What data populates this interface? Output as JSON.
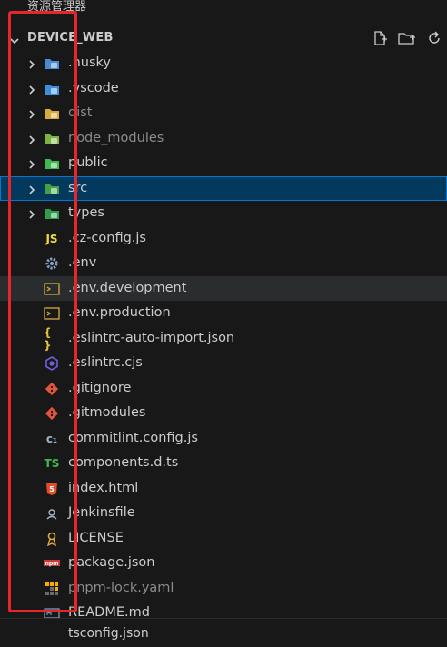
{
  "panel": {
    "title": "资源管理器"
  },
  "section": {
    "title": "DEVICE_WEB",
    "actions": [
      {
        "name": "new-file-icon"
      },
      {
        "name": "new-folder-icon"
      },
      {
        "name": "refresh-icon"
      }
    ]
  },
  "tree": [
    {
      "label": ".husky",
      "kind": "folder",
      "icon": "husky-folder-icon",
      "color": "#4a8bd1",
      "dim": false
    },
    {
      "label": ".vscode",
      "kind": "folder",
      "icon": "vscode-folder-icon",
      "color": "#3c8fd9",
      "dim": false
    },
    {
      "label": "dist",
      "kind": "folder",
      "icon": "dist-folder-icon",
      "color": "#d9a93b",
      "dim": true
    },
    {
      "label": "node_modules",
      "kind": "folder",
      "icon": "node-folder-icon",
      "color": "#7cb342",
      "dim": true
    },
    {
      "label": "public",
      "kind": "folder",
      "icon": "public-folder-icon",
      "color": "#3fb950",
      "dim": false
    },
    {
      "label": "src",
      "kind": "folder",
      "icon": "src-folder-icon",
      "color": "#43a047",
      "dim": false,
      "selected": true
    },
    {
      "label": "types",
      "kind": "folder",
      "icon": "types-folder-icon",
      "color": "#2e9b4d",
      "dim": false
    },
    {
      "label": ".cz-config.js",
      "kind": "file",
      "icon": "javascript-icon",
      "glyph": "JS",
      "color": "#f1dd35",
      "dim": false
    },
    {
      "label": ".env",
      "kind": "file",
      "icon": "gear-icon",
      "color": "#8aa4c8",
      "dim": false
    },
    {
      "label": ".env.development",
      "kind": "file",
      "icon": "terminal-icon",
      "color": "#d9a93b",
      "dim": false,
      "hover": true
    },
    {
      "label": ".env.production",
      "kind": "file",
      "icon": "terminal-icon",
      "color": "#d9a93b",
      "dim": false
    },
    {
      "label": ".eslintrc-auto-import.json",
      "kind": "file",
      "icon": "json-icon",
      "glyph": "{ }",
      "color": "#e8c13a",
      "dim": false
    },
    {
      "label": ".eslintrc.cjs",
      "kind": "file",
      "icon": "eslint-icon",
      "color": "#6b5fe0",
      "dim": false
    },
    {
      "label": ".gitignore",
      "kind": "file",
      "icon": "git-icon",
      "color": "#e4553a",
      "dim": false
    },
    {
      "label": ".gitmodules",
      "kind": "file",
      "icon": "git-icon",
      "color": "#e4553a",
      "dim": false
    },
    {
      "label": "commitlint.config.js",
      "kind": "file",
      "icon": "commitlint-icon",
      "glyph": "c₁",
      "color": "#9fb3c8",
      "dim": false
    },
    {
      "label": "components.d.ts",
      "kind": "file",
      "icon": "typescript-icon",
      "glyph": "TS",
      "color": "#3fb950",
      "dim": false
    },
    {
      "label": "index.html",
      "kind": "file",
      "icon": "html-icon",
      "glyph": "5",
      "color": "#e44d26",
      "dim": false
    },
    {
      "label": "Jenkinsfile",
      "kind": "file",
      "icon": "jenkins-icon",
      "color": "#a7b3bf",
      "dim": false
    },
    {
      "label": "LICENSE",
      "kind": "file",
      "icon": "license-icon",
      "color": "#d9a93b",
      "dim": false
    },
    {
      "label": "package.json",
      "kind": "file",
      "icon": "npm-icon",
      "glyph": "npm",
      "color": "#cb3837",
      "dim": false
    },
    {
      "label": "pnpm-lock.yaml",
      "kind": "file",
      "icon": "pnpm-icon",
      "color": "#f9ad00",
      "dim": true
    },
    {
      "label": "README.md",
      "kind": "file",
      "icon": "readme-icon",
      "color": "#8aa4c8",
      "dim": false
    }
  ],
  "partial_bottom": "tsconfig.json"
}
